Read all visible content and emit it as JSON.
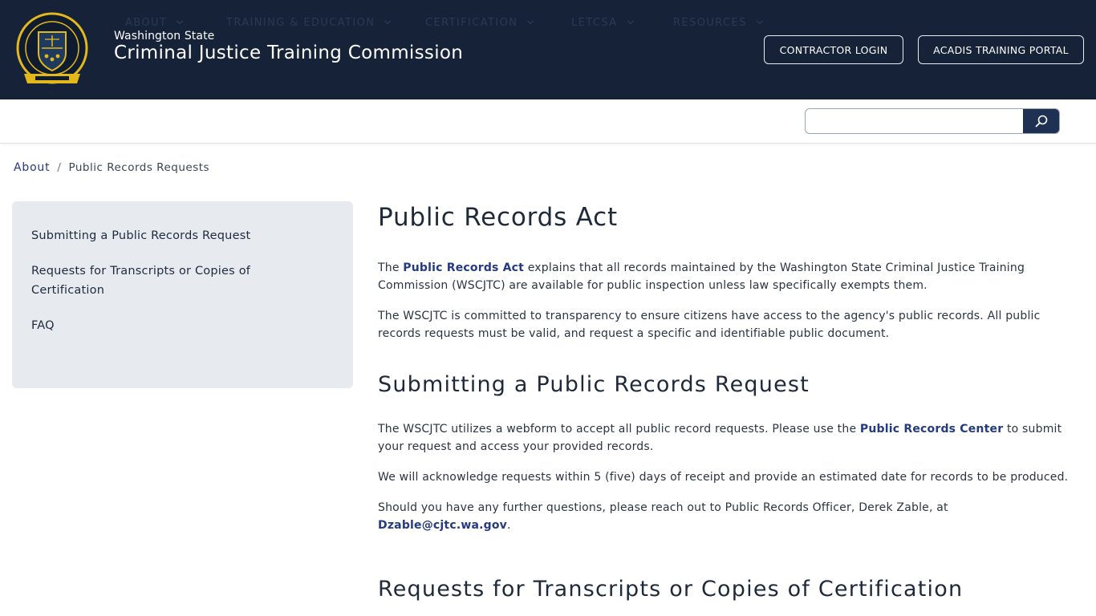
{
  "header": {
    "agency_small": "Washington State",
    "agency_large": "Criminal Justice Training Commission",
    "seal_icon": "cjtc-seal-icon",
    "buttons": {
      "contractor_login": "CONTRACTOR LOGIN",
      "acadis_portal": "ACADIS TRAINING PORTAL"
    }
  },
  "nav": {
    "items": [
      {
        "label": "ABOUT"
      },
      {
        "label": "TRAINING & EDUCATION"
      },
      {
        "label": "CERTIFICATION"
      },
      {
        "label": "LETCSA"
      },
      {
        "label": "RESOURCES"
      }
    ],
    "search": {
      "placeholder": "",
      "value": ""
    }
  },
  "breadcrumb": {
    "parent": "About",
    "separator": "/",
    "current": "Public Records Requests"
  },
  "sidebar": {
    "items": [
      {
        "label": "Submitting a Public Records Request"
      },
      {
        "label": "Requests for Transcripts or Copies of Certification"
      },
      {
        "label": "FAQ"
      }
    ]
  },
  "content": {
    "title": "Public Records Act",
    "intro_1": {
      "pre": "The ",
      "link": "Public Records Act",
      "post": " explains that all records maintained by the Washington State Criminal Justice Training Commission (WSCJTC) are available for public inspection unless law specifically exempts them."
    },
    "intro_2": "The WSCJTC is committed to transparency to ensure citizens have access to the agency's public records.  All public records requests must be valid, and request a specific and identifiable public document.",
    "section_1_title": "Submitting a Public Records Request",
    "section_1_p1": {
      "pre": "The WSCJTC utilizes a webform to accept all public record requests. Please use the ",
      "link": "Public Records Center",
      "post": " to submit your request and access your provided records."
    },
    "section_1_p2": "We will acknowledge requests within 5 (five) days of receipt and provide an estimated date for records to be produced.",
    "section_1_p3": {
      "pre": "Should you have any further questions, please reach out to Public Records Officer, Derek Zable, at ",
      "link": "Dzable@cjtc.wa.gov",
      "post": "."
    },
    "section_2_title": "Requests for Transcripts or Copies of Certification"
  },
  "colors": {
    "header_bg": "#152238",
    "link": "#243a82",
    "sidebar_bg": "#e7ebef",
    "search_button": "#1f3152",
    "seal_gold": "#e3b81d"
  }
}
